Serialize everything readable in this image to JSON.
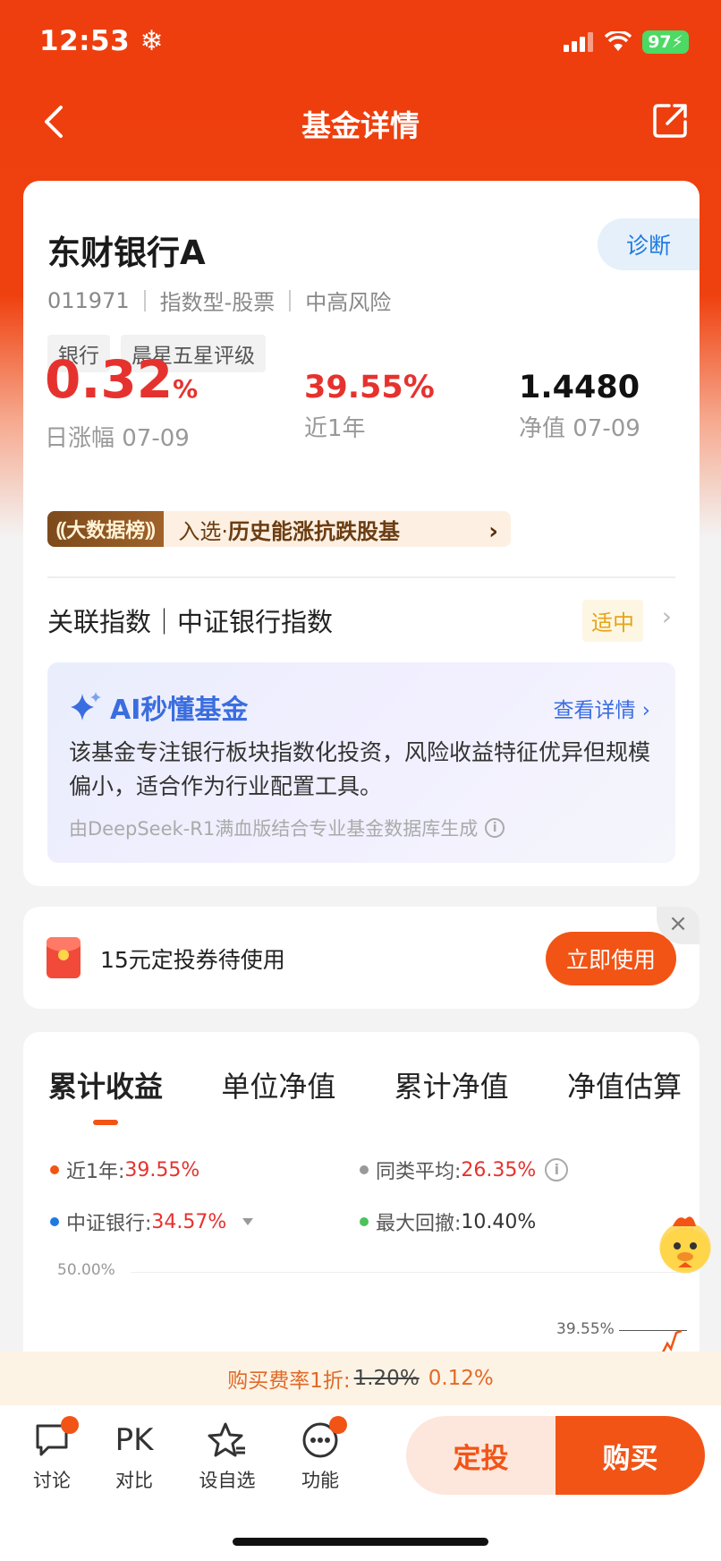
{
  "status": {
    "time": "12:53",
    "battery": "97"
  },
  "nav": {
    "title": "基金详情"
  },
  "fund": {
    "name": "东财银行A",
    "diagnose": "诊断",
    "code": "011971",
    "type": "指数型-股票",
    "risk": "中高风险",
    "tags": [
      "银行",
      "晨星五星评级"
    ],
    "stats": {
      "daily_value": "0.32",
      "daily_unit": "%",
      "daily_label": "日涨幅 07-09",
      "year_value": "39.55%",
      "year_label": "近1年",
      "nav_value": "1.4480",
      "nav_label": "净值 07-09"
    },
    "ranking": {
      "badge": "大数据榜",
      "prefix": "入选·",
      "text": "历史能涨抗跌股基"
    },
    "index": {
      "title": "关联指数｜中证银行指数",
      "level": "适中"
    },
    "ai": {
      "title": "AI秒懂基金",
      "more": "查看详情",
      "text": "该基金专注银行板块指数化投资，风险收益特征优异但规模偏小，适合作为行业配置工具。",
      "footer": "由DeepSeek-R1满血版结合专业基金数据库生成"
    }
  },
  "coupon": {
    "text": "15元定投券待使用",
    "button": "立即使用"
  },
  "chart": {
    "tabs": [
      "累计收益",
      "单位净值",
      "累计净值",
      "净值估算"
    ],
    "legend": [
      {
        "label": "近1年:",
        "value": "39.55%",
        "color": "#f25416"
      },
      {
        "label": "同类平均:",
        "value": "26.35%",
        "color": "#999999"
      },
      {
        "label": "中证银行:",
        "value": "34.57%",
        "color": "#1f7ae0"
      },
      {
        "label": "最大回撤:",
        "value": "10.40%",
        "color": "#4cc25a"
      }
    ],
    "ytick_top": "50.00%",
    "end_label": "39.55%"
  },
  "fee": {
    "prefix": "购买费率1折:",
    "old": "1.20%",
    "new": "0.12%"
  },
  "bottom": {
    "items": [
      {
        "label": "讨论"
      },
      {
        "label": "对比",
        "glyph": "PK"
      },
      {
        "label": "设自选"
      },
      {
        "label": "功能"
      }
    ],
    "sip": "定投",
    "buy": "购买"
  },
  "colors": {
    "brand": "#f25416",
    "up": "#e6322e",
    "ai": "#3a6de0"
  }
}
